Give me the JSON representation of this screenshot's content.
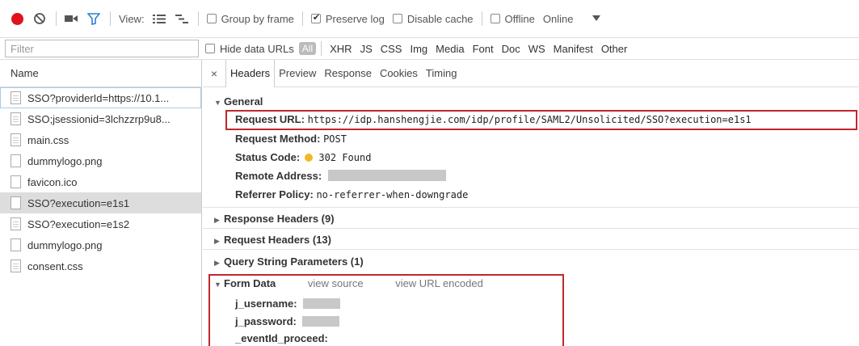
{
  "toolbar": {
    "view_label": "View:",
    "group_by_frame": "Group by frame",
    "preserve_log": "Preserve log",
    "disable_cache": "Disable cache",
    "offline": "Offline",
    "online": "Online"
  },
  "filter": {
    "placeholder": "Filter",
    "hide_data_urls": "Hide data URLs",
    "types": [
      "All",
      "XHR",
      "JS",
      "CSS",
      "Img",
      "Media",
      "Font",
      "Doc",
      "WS",
      "Manifest",
      "Other"
    ]
  },
  "requests": {
    "header": "Name",
    "items": [
      "SSO?providerId=https://10.1...",
      "SSO;jsessionid=3lchzzrp9u8...",
      "main.css",
      "dummylogo.png",
      "favicon.ico",
      "SSO?execution=e1s1",
      "SSO?execution=e1s2",
      "dummylogo.png",
      "consent.css"
    ]
  },
  "tabs": [
    "Headers",
    "Preview",
    "Response",
    "Cookies",
    "Timing"
  ],
  "general": {
    "title": "General",
    "request_url_label": "Request URL:",
    "request_url": "https://idp.hanshengjie.com/idp/profile/SAML2/Unsolicited/SSO?execution=e1s1",
    "request_method_label": "Request Method:",
    "request_method": "POST",
    "status_code_label": "Status Code:",
    "status_code": "302 Found",
    "status_color": "#f2b824",
    "remote_address_label": "Remote Address:",
    "referrer_policy_label": "Referrer Policy:",
    "referrer_policy": "no-referrer-when-downgrade"
  },
  "sections": {
    "response_headers": "Response Headers (9)",
    "request_headers": "Request Headers (13)",
    "query_string": "Query String Parameters (1)"
  },
  "form_data": {
    "title": "Form Data",
    "view_source": "view source",
    "view_url_encoded": "view URL encoded",
    "username_label": "j_username:",
    "password_label": "j_password:",
    "event_label": "_eventId_proceed:"
  }
}
